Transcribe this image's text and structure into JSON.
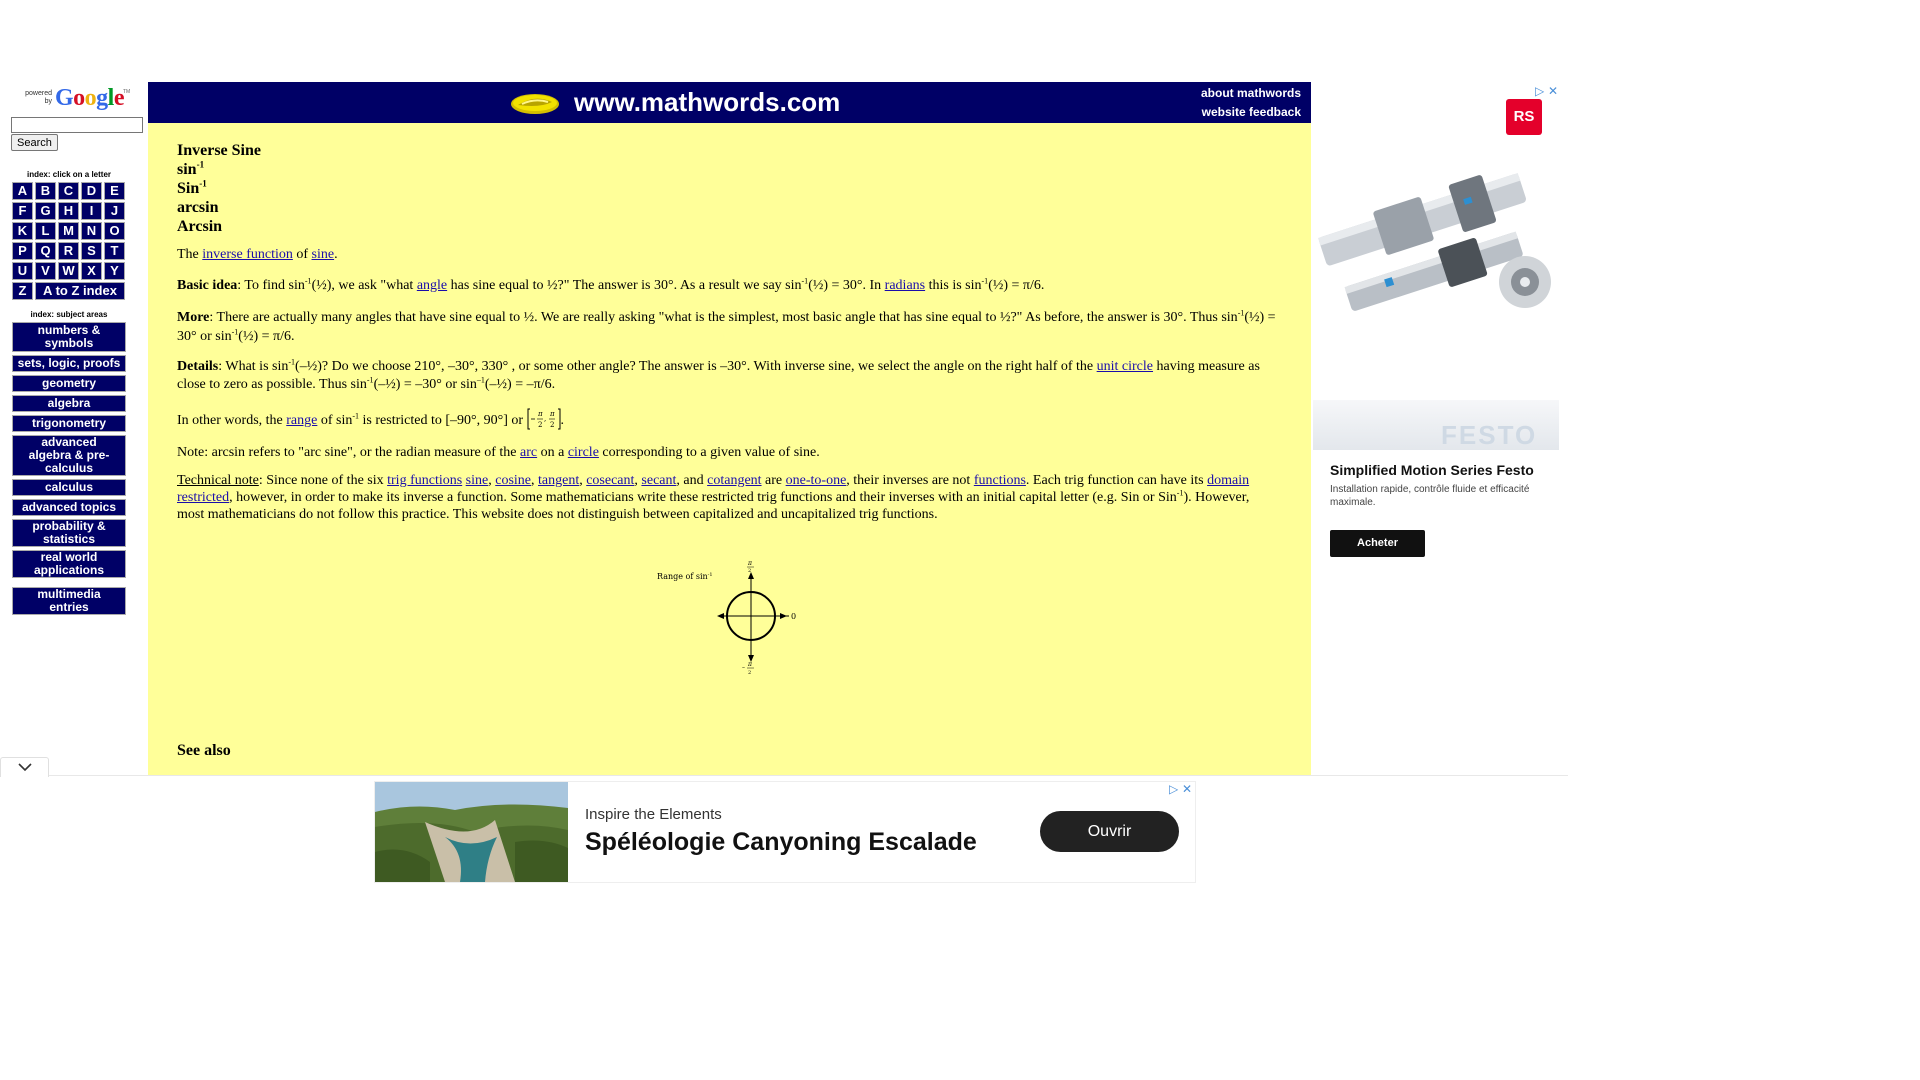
{
  "sidebar": {
    "google": {
      "powered": "powered",
      "by": "by",
      "word": "Google",
      "tm": "TM"
    },
    "search_value": "",
    "search_button": "Search",
    "letter_index_title": "index: click on a letter",
    "letters": [
      [
        "A",
        "B",
        "C",
        "D",
        "E"
      ],
      [
        "F",
        "G",
        "H",
        "I",
        "J"
      ],
      [
        "K",
        "L",
        "M",
        "N",
        "O"
      ],
      [
        "P",
        "Q",
        "R",
        "S",
        "T"
      ],
      [
        "U",
        "V",
        "W",
        "X",
        "Y"
      ]
    ],
    "letter_z": "Z",
    "atoz": "A to Z index",
    "subject_title": "index: subject areas",
    "subjects": [
      "numbers & symbols",
      "sets, logic, proofs",
      "geometry",
      "algebra",
      "trigonometry",
      "advanced algebra & pre-calculus",
      "calculus",
      "advanced topics",
      "probability & statistics",
      "real world applications"
    ],
    "multimedia": "multimedia entries"
  },
  "header": {
    "site": "www.mathwords.com",
    "about": "about mathwords",
    "feedback": "website feedback"
  },
  "entry": {
    "terms": [
      "Inverse Sine",
      "sin",
      "Sin",
      "arcsin",
      "Arcsin"
    ],
    "sup": "-1",
    "def_pre": "The ",
    "def_link1": "inverse function",
    "def_mid": " of ",
    "def_link2": "sine",
    "def_end": ".",
    "basic_label": "Basic idea",
    "basic_1": ": To find sin",
    "basic_2": "(½), we ask \"what ",
    "basic_link_angle": "angle",
    "basic_3": " has sine equal to ½?\" The answer is 30°. As a result we say sin",
    "basic_4": "(½) = 30°. In ",
    "basic_link_radians": "radians",
    "basic_5": " this is sin",
    "basic_6": "(½) = π/6.",
    "more_label": "More",
    "more_1": ": There are actually many angles that have sine equal to ½. We are really asking \"what is the simplest, most basic angle that has sine equal to ½?\" As before, the answer is 30°. Thus sin",
    "more_2": "(½) = 30° or sin",
    "more_3": "(½) = π/6.",
    "details_label": "Details",
    "details_1": ": What is sin",
    "details_2": "(–½)? Do we choose 210°, –30°, 330° , or some other angle? The answer is –30°. With inverse sine, we select the angle on the right half of the ",
    "details_link": "unit circle",
    "details_3": " having measure as close to zero as possible. Thus sin",
    "details_4": "(–½) = –30° or sin",
    "details_sup2": "–1",
    "details_5": "(–½) = –π/6.",
    "range_1": "In other words, the ",
    "range_link": "range",
    "range_2": " of sin",
    "range_3": " is restricted to [–90°, 90°] or ",
    "note_1": "Note: arcsin refers to \"arc sine\", or the radian measure of the ",
    "note_link1": "arc",
    "note_2": " on a ",
    "note_link2": "circle",
    "note_3": " corresponding to a given value of sine.",
    "tech_label": "Technical note",
    "tech_1": ": Since none of the six ",
    "tech_links": [
      "trig functions",
      "sine",
      "cosine",
      "tangent",
      "cosecant",
      "secant",
      "cotangent"
    ],
    "tech_and": ", and ",
    "tech_are": " are ",
    "tech_link_oto": "one-to-one",
    "tech_2": ", their inverses are not ",
    "tech_link_functions": "functions",
    "tech_3": ". Each trig function can have its ",
    "tech_link_domain": "domain restricted",
    "tech_4": ", however, in order to make its inverse a function. Some mathematicians write these restricted trig functions and their inverses with an initial capital letter (e.g. Sin or Sin",
    "tech_5": "). However, most mathematicians do not follow this practice. This website does not distinguish between capitalized and uncapitalized trig functions.",
    "figure_label": "Range of sin",
    "figure_zero": "0",
    "see_also": "See also"
  },
  "ad_right": {
    "brand_logo": "RS",
    "festo_word": "FESTO",
    "headline": "Simplified Motion Series Festo",
    "desc": "Installation rapide, contrôle fluide et efficacité maximale.",
    "cta": "Acheter"
  },
  "ad_bottom": {
    "brand": "Inspire the Elements",
    "headline": "Spéléologie Canyoning Escalade",
    "cta": "Ouvrir"
  },
  "colors": {
    "navy": "#000066",
    "content_bg": "#ffff99"
  }
}
